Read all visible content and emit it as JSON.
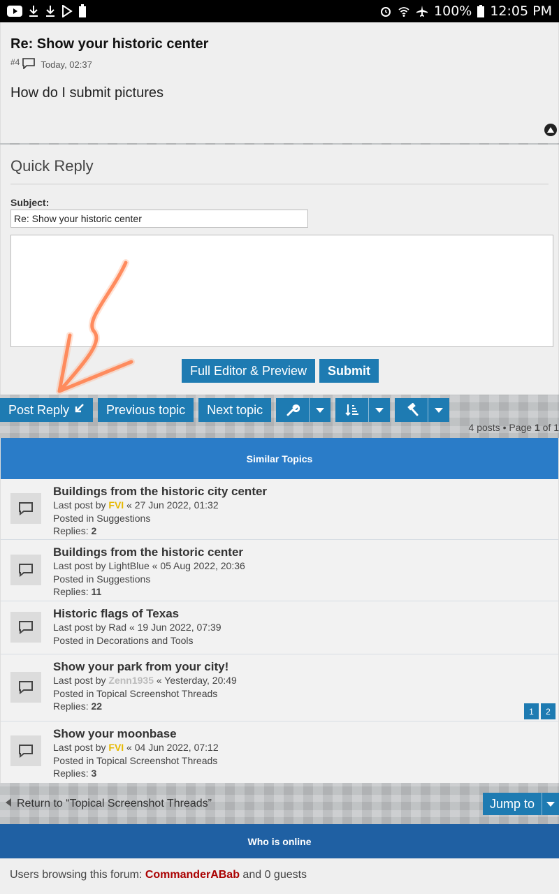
{
  "status_bar": {
    "battery": "100%",
    "time": "12:05 PM",
    "left_icons": [
      "youtube-icon",
      "download-icon",
      "download-icon",
      "play-store-icon",
      "battery-saver-icon"
    ],
    "right_icons": [
      "alarm-icon",
      "wifi-icon",
      "airplane-icon",
      "battery-icon"
    ]
  },
  "post": {
    "title": "Re: Show your historic center",
    "number": "#4",
    "timestamp": "Today, 02:37",
    "body": "How do I submit pictures"
  },
  "quick_reply": {
    "title": "Quick Reply",
    "subject_label": "Subject:",
    "subject_value": "Re: Show your historic center",
    "full_editor_label": "Full Editor & Preview",
    "submit_label": "Submit"
  },
  "actions": {
    "post_reply": "Post Reply",
    "previous_topic": "Previous topic",
    "next_topic": "Next topic",
    "pagination": {
      "posts": "4 posts • Page ",
      "current": "1",
      "of": " of 1"
    }
  },
  "similar": {
    "header": "Similar Topics",
    "topics": [
      {
        "title": "Buildings from the historic city center",
        "last_post_prefix": "Last post by ",
        "user": "FVI",
        "date": " « 27 Jun 2022, 01:32",
        "posted_in": "Posted in Suggestions",
        "replies_label": "Replies: ",
        "replies": "2"
      },
      {
        "title": "Buildings from the historic center",
        "last_post_prefix": "Last post by ",
        "user": "LightBlue",
        "date": " « 05 Aug 2022, 20:36",
        "posted_in": "Posted in Suggestions",
        "replies_label": "Replies: ",
        "replies": "11"
      },
      {
        "title": "Historic flags of Texas",
        "last_post_prefix": "Last post by ",
        "user": "Rad",
        "date": " « 19 Jun 2022, 07:39",
        "posted_in": "Posted in Decorations and Tools"
      },
      {
        "title": "Show your park from your city!",
        "last_post_prefix": "Last post by ",
        "user": "Zenn1935",
        "date": " « Yesterday, 20:49",
        "posted_in": "Posted in Topical Screenshot Threads",
        "replies_label": "Replies: ",
        "replies": "22",
        "pages": [
          "1",
          "2"
        ]
      },
      {
        "title": "Show your moonbase",
        "last_post_prefix": "Last post by ",
        "user": "FVI",
        "date": " « 04 Jun 2022, 07:12",
        "posted_in": "Posted in Topical Screenshot Threads",
        "replies_label": "Replies: ",
        "replies": "3"
      }
    ]
  },
  "footer": {
    "return_link": "Return to “Topical Screenshot Threads”",
    "jump_to": "Jump to",
    "who_is_online": "Who is online",
    "browsing_prefix": "Users browsing this forum: ",
    "browsing_user": "CommanderABab",
    "browsing_suffix": " and 0 guests"
  },
  "colors": {
    "button_blue": "#1e7bb2",
    "header_blue": "#2a7cc8",
    "online_blue": "#1f60a3",
    "annotation_arrow": "#ff6a33"
  }
}
